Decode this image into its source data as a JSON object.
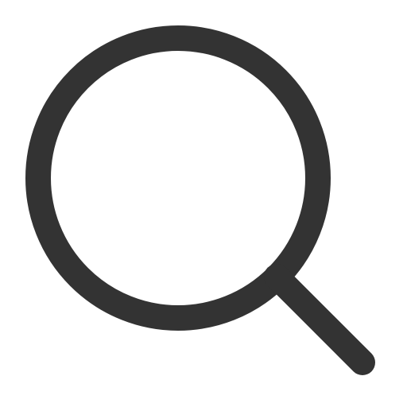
{
  "icon": {
    "name": "search-icon",
    "color": "#333333",
    "background": "#ffffff"
  }
}
